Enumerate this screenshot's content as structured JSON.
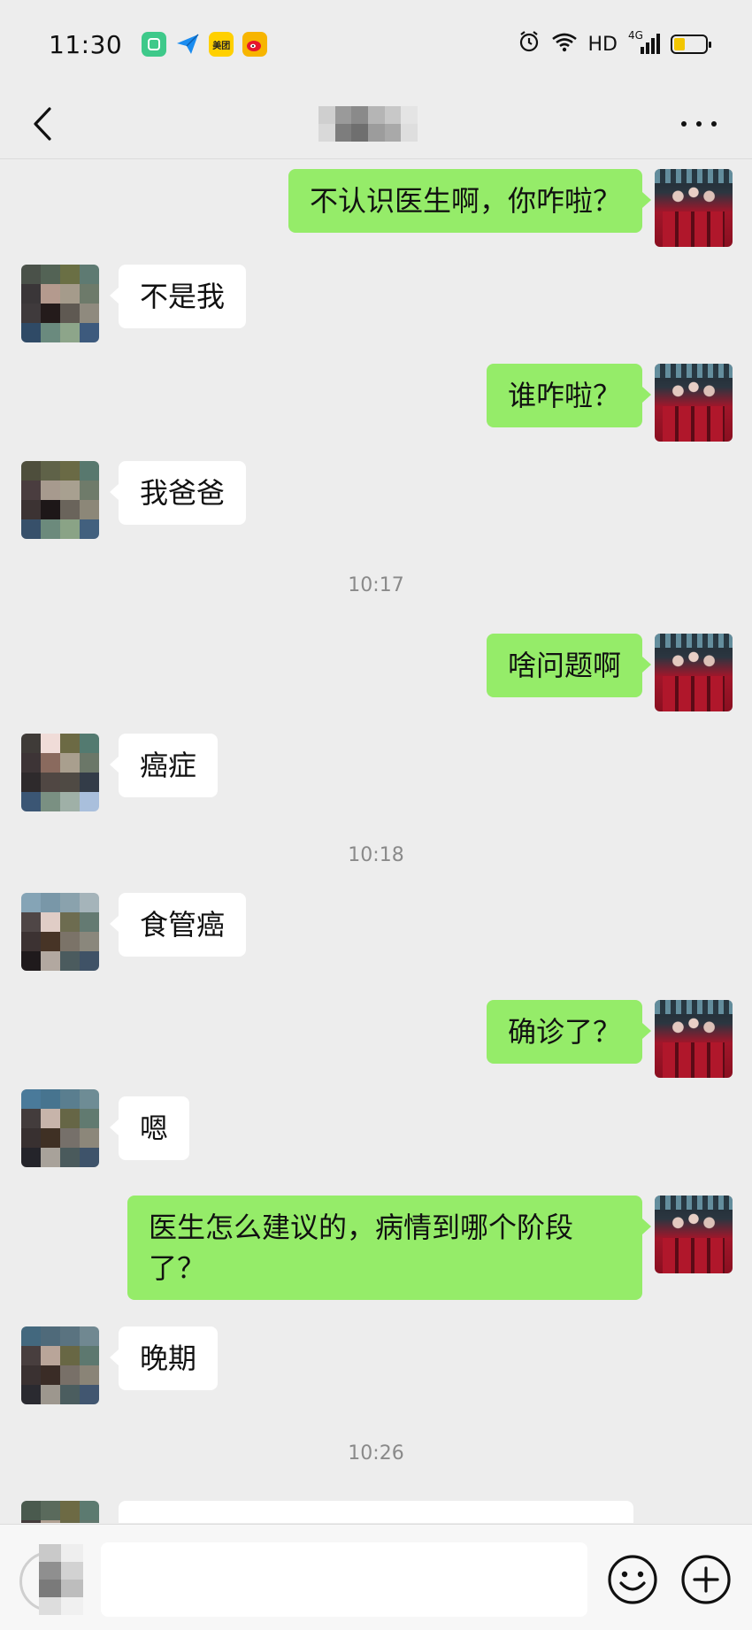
{
  "status_bar": {
    "time": "11:30",
    "notification_icons": [
      "notification-app-icon",
      "paper-plane-icon",
      "meituan-icon",
      "weibo-icon"
    ],
    "meituan_label": "美团",
    "network_label": "HD",
    "signal_label": "4G",
    "battery_level": 0.35
  },
  "nav": {
    "title": "",
    "back_icon": "chevron-left-icon",
    "more_icon": "more-dots-icon"
  },
  "messages": [
    {
      "side": "out",
      "text": "不认识医生啊，你咋啦？"
    },
    {
      "side": "in",
      "text": "不是我"
    },
    {
      "side": "out",
      "text": "谁咋啦？"
    },
    {
      "side": "in",
      "text": "我爸爸"
    },
    {
      "timestamp": "10:17"
    },
    {
      "side": "out",
      "text": "啥问题啊"
    },
    {
      "side": "in",
      "text": "癌症"
    },
    {
      "timestamp": "10:18"
    },
    {
      "side": "in",
      "text": "食管癌"
    },
    {
      "side": "out",
      "text": "确诊了？"
    },
    {
      "side": "in",
      "text": "嗯"
    },
    {
      "side": "out",
      "text": "医生怎么建议的，病情到哪个阶段\n了？"
    },
    {
      "side": "in",
      "text": "晚期"
    },
    {
      "timestamp": "10:26"
    }
  ],
  "input_bar": {
    "placeholder": "",
    "voice_icon": "voice-icon",
    "emoji_icon": "emoji-icon",
    "plus_icon": "plus-icon"
  },
  "colors": {
    "outgoing_bubble": "#95ec69",
    "incoming_bubble": "#ffffff",
    "background": "#ededed"
  }
}
